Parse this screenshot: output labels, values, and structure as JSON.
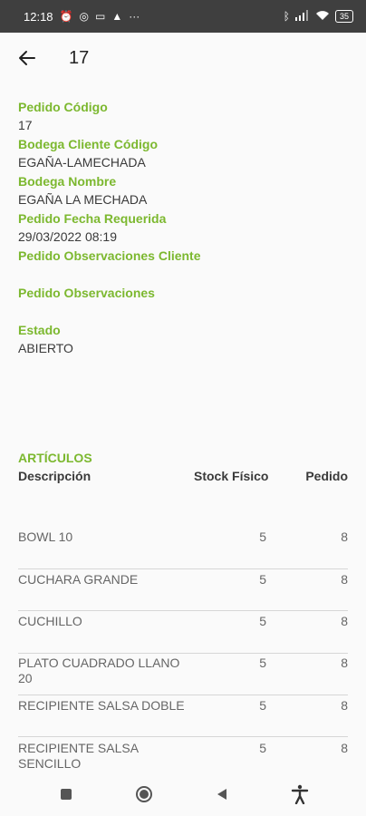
{
  "status_bar": {
    "time": "12:18",
    "left_icons": [
      "alarm-icon",
      "whatsapp-icon",
      "cast-icon",
      "warning-icon",
      "more-icon"
    ],
    "right_icons": [
      "bluetooth-icon",
      "signal-icon",
      "wifi-icon"
    ],
    "battery": "35"
  },
  "app_bar": {
    "title": "17"
  },
  "fields": [
    {
      "label": "Pedido Código",
      "value": "17"
    },
    {
      "label": "Bodega Cliente Código",
      "value": "EGAÑA-LAMECHADA"
    },
    {
      "label": "Bodega Nombre",
      "value": "EGAÑA LA MECHADA"
    },
    {
      "label": "Pedido Fecha Requerida",
      "value": "29/03/2022 08:19"
    },
    {
      "label": "Pedido Observaciones Cliente",
      "value": ""
    },
    {
      "label": "Pedido Observaciones",
      "value": ""
    },
    {
      "label": "Estado",
      "value": "ABIERTO"
    }
  ],
  "articles": {
    "title": "ARTÍCULOS",
    "headers": {
      "description": "Descripción",
      "stock": "Stock Físico",
      "order": "Pedido"
    },
    "rows": [
      {
        "description": "BOWL 10",
        "stock": "5",
        "order": "8"
      },
      {
        "description": "CUCHARA GRANDE",
        "stock": "5",
        "order": "8"
      },
      {
        "description": "CUCHILLO",
        "stock": "5",
        "order": "8"
      },
      {
        "description": "PLATO CUADRADO LLANO 20",
        "stock": "5",
        "order": "8"
      },
      {
        "description": "RECIPIENTE SALSA DOBLE",
        "stock": "5",
        "order": "8"
      },
      {
        "description": "RECIPIENTE SALSA SENCILLO",
        "stock": "5",
        "order": "8"
      }
    ]
  },
  "colors": {
    "accent": "#7cb82f",
    "status_bar": "#3f3f3f"
  }
}
